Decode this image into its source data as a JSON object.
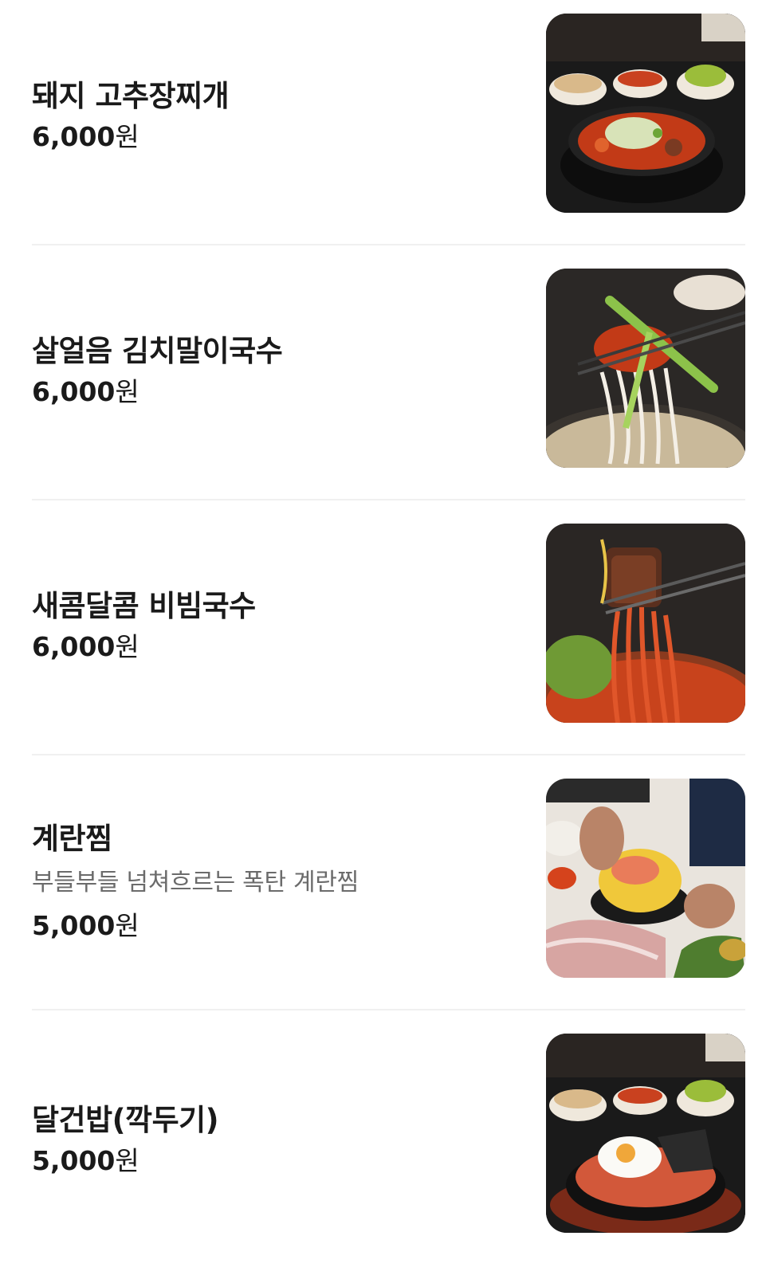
{
  "menu": {
    "items": [
      {
        "name": "돼지 고추장찌개",
        "description": "",
        "price": "6,000",
        "currency": "원",
        "photo": "pork-gochujang-stew-photo"
      },
      {
        "name": "살얼음 김치말이국수",
        "description": "",
        "price": "6,000",
        "currency": "원",
        "photo": "kimchi-noodle-photo"
      },
      {
        "name": "새콤달콤 비빔국수",
        "description": "",
        "price": "6,000",
        "currency": "원",
        "photo": "bibim-noodle-photo"
      },
      {
        "name": "계란찜",
        "description": "부들부들 넘쳐흐르는 폭탄 계란찜",
        "price": "5,000",
        "currency": "원",
        "photo": "steamed-egg-photo"
      },
      {
        "name": "달건밥(깍두기)",
        "description": "",
        "price": "5,000",
        "currency": "원",
        "photo": "egg-rice-photo"
      }
    ]
  }
}
